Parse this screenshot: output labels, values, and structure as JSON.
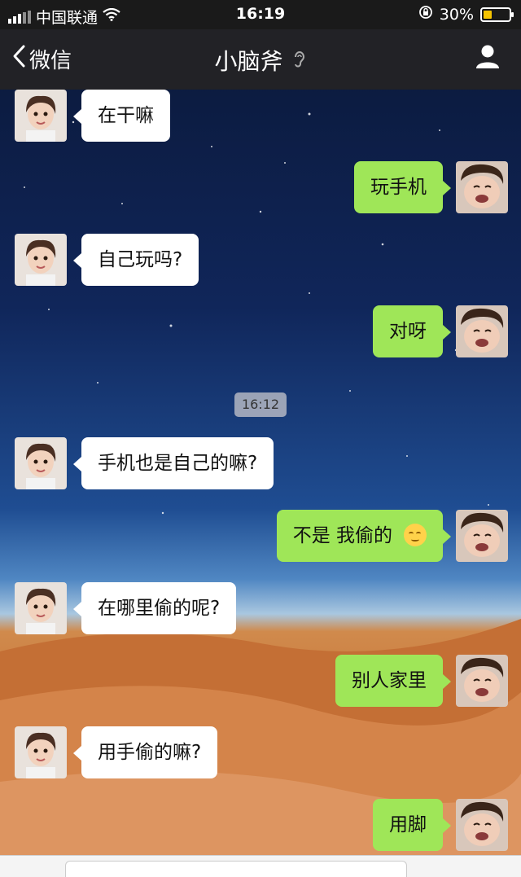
{
  "status_bar": {
    "carrier": "中国联通",
    "time": "16:19",
    "battery_percent": "30%",
    "battery_level": 0.3
  },
  "nav": {
    "back_label": "微信",
    "title": "小脑斧",
    "title_icon": "ear-icon",
    "profile_icon": "person-icon"
  },
  "chat": {
    "timestamp": "16:12",
    "messages": [
      {
        "side": "left",
        "text": "在干嘛"
      },
      {
        "side": "right",
        "text": "玩手机"
      },
      {
        "side": "left",
        "text": "自己玩吗?"
      },
      {
        "side": "right",
        "text": "对呀"
      },
      {
        "side": "left",
        "text": "手机也是自己的嘛?"
      },
      {
        "side": "right",
        "text": "不是 我偷的",
        "emoji": "smirk-emoji"
      },
      {
        "side": "left",
        "text": "在哪里偷的呢?"
      },
      {
        "side": "right",
        "text": "别人家里"
      },
      {
        "side": "left",
        "text": "用手偷的嘛?"
      },
      {
        "side": "right",
        "text": "用脚"
      }
    ]
  },
  "colors": {
    "bubble_mine": "#9fe658",
    "bubble_theirs": "#ffffff",
    "navbar": "#222226"
  }
}
